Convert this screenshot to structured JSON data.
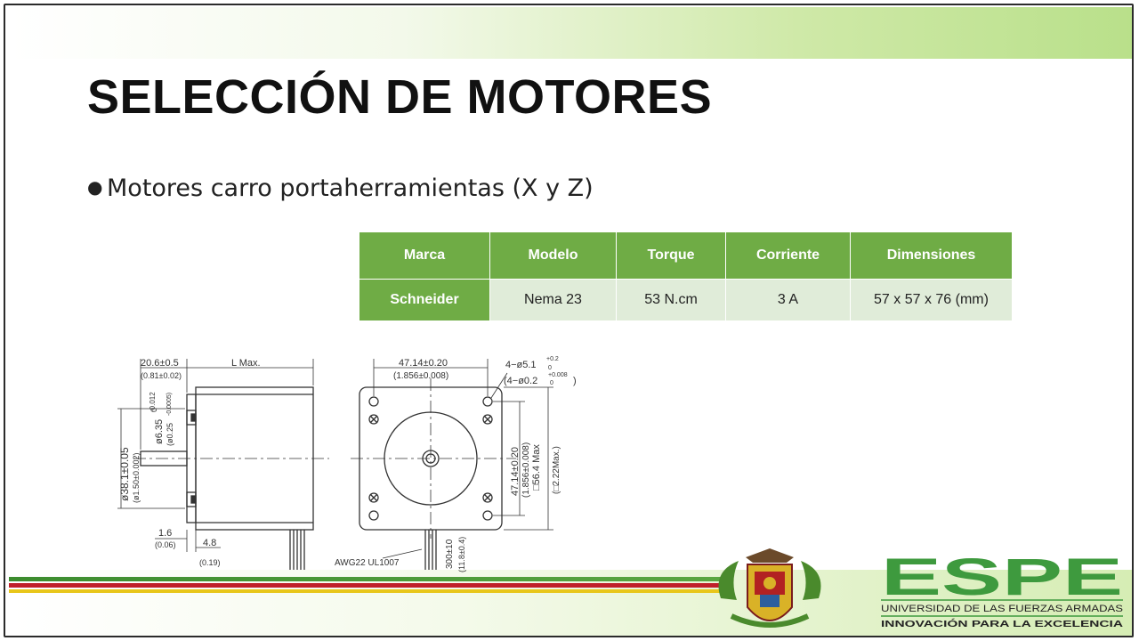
{
  "slide": {
    "title": "SELECCIÓN DE MOTORES",
    "bullet": "Motores carro portaherramientas (X y Z)"
  },
  "table": {
    "headers": [
      "Marca",
      "Modelo",
      "Torque",
      "Corriente",
      "Dimensiones"
    ],
    "rows": [
      [
        "Schneider",
        "Nema 23",
        "53 N.cm",
        "3 A",
        "57 x 57 x 76 (mm)"
      ]
    ]
  },
  "drawing": {
    "side": {
      "shaft_len": "20.6±0.5",
      "shaft_len_in": "(0.81±0.02)",
      "length": "L Max.",
      "shaft_dia_top": "0",
      "shaft_dia": "ø6.35",
      "shaft_dia_tol": "-0.012",
      "shaft_dia_in": "(ø0.25",
      "shaft_dia_in_tol": "-0.0005)",
      "pilot_dia": "ø38.1±0.05",
      "pilot_dia_in": "(ø1.50±0.002)",
      "flange": "1.6",
      "flange_in": "(0.06)",
      "boss": "4.8",
      "boss_in": "(0.19)"
    },
    "front": {
      "hole_pitch": "47.14±0.20",
      "hole_pitch_in": "(1.856±0.008)",
      "hole_spec": "4−ø5.1",
      "hole_tol_top": "+0.2",
      "hole_tol_bottom": "0",
      "hole_spec_in": "(4−ø0.2",
      "hole_in_top": "+0.008",
      "hole_in_bottom": "0",
      "hole_in_close": ")",
      "v_pitch": "47.14±0.20",
      "v_pitch_in": "(1.856±0.008)",
      "square": "□56.4 Max",
      "square_in": "(□2.22Max.)",
      "wire": "AWG22  UL1007",
      "lead": "300±10",
      "lead_in": "(11.8±0.4)"
    }
  },
  "logo": {
    "name": "ESPE",
    "line1": "UNIVERSIDAD DE LAS FUERZAS ARMADAS",
    "line2": "INNOVACIÓN PARA LA EXCELENCIA"
  },
  "colors": {
    "accent": "#6fac45",
    "accent_light": "#e0ecd9",
    "stripe_red": "#c0202a",
    "stripe_green": "#3c8c2e",
    "logo_green": "#3e9a3e"
  }
}
